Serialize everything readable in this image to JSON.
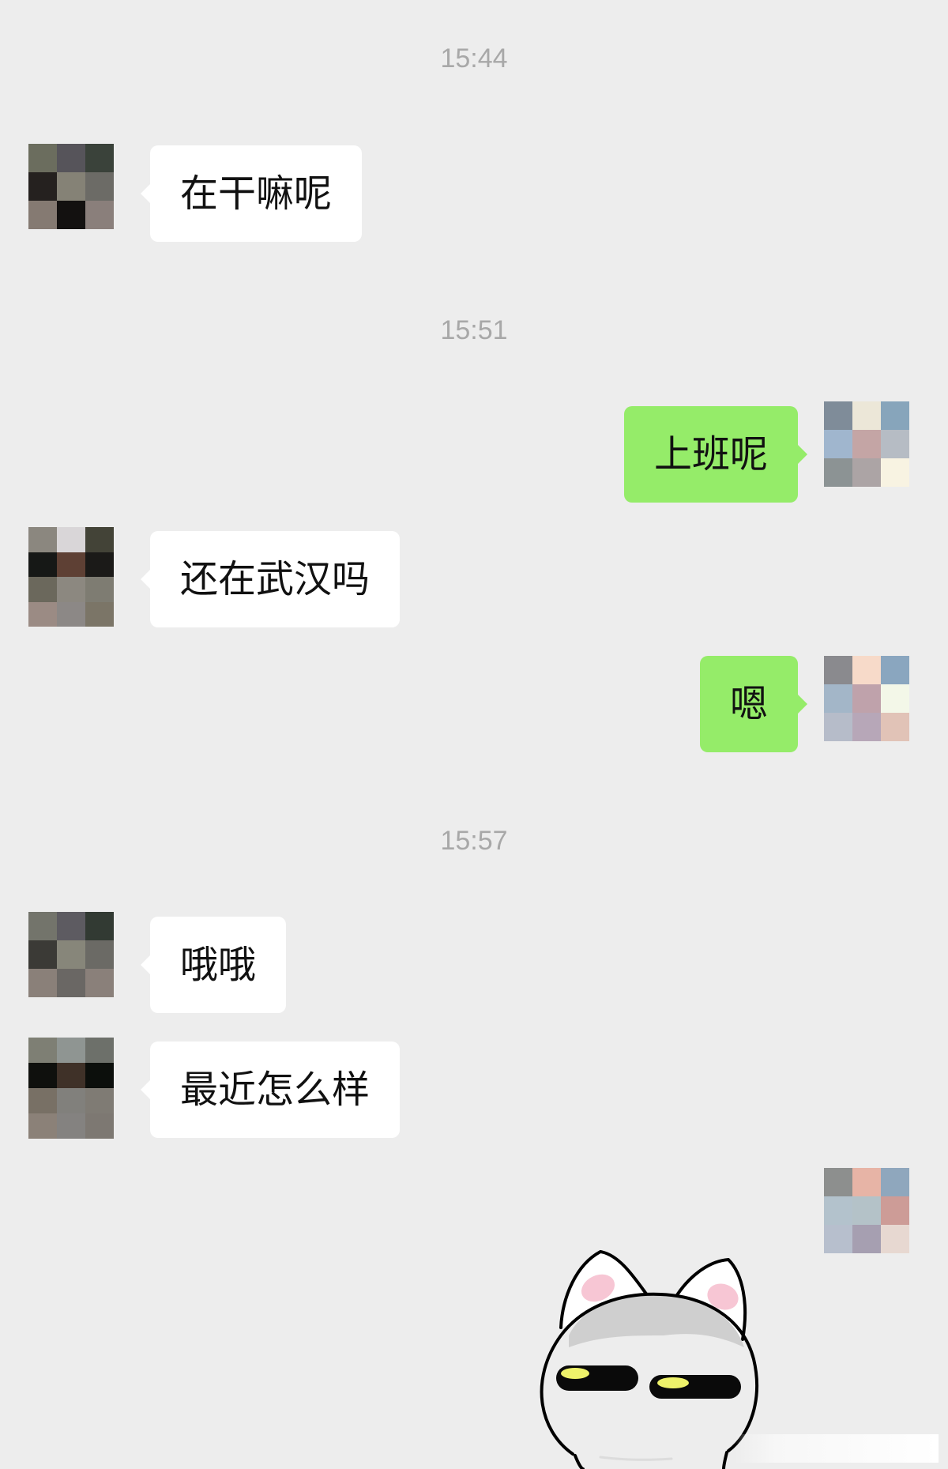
{
  "conversation": {
    "timestamps": [
      "15:44",
      "15:51",
      "15:57"
    ],
    "messages": [
      {
        "sender": "contact",
        "text": "在干嘛呢"
      },
      {
        "sender": "self",
        "text": "上班呢"
      },
      {
        "sender": "contact",
        "text": "还在武汉吗"
      },
      {
        "sender": "self",
        "text": "嗯"
      },
      {
        "sender": "contact",
        "text": "哦哦"
      },
      {
        "sender": "contact",
        "text": "最近怎么样"
      },
      {
        "sender": "self",
        "type": "sticker",
        "sticker": "smug-cat-sticker"
      }
    ]
  },
  "colors": {
    "background": "#ededed",
    "incoming_bubble": "#ffffff",
    "outgoing_bubble": "#95ec69",
    "timestamp_text": "#a8a8a8"
  },
  "avatars": {
    "contact": [
      [
        "#6b6d5e",
        "#56545a",
        "#3a423a",
        "#25211f",
        "#858276",
        "#6c6b66",
        "#857a72",
        "#131110",
        "#8a7f7b"
      ],
      [
        "#8b877f",
        "#d9d6d8",
        "#434337",
        "#161816",
        "#5e4034",
        "#1b1a18",
        "#6b685c",
        "#8c8880",
        "#7e7c72",
        "#9b8b84",
        "#8c8886",
        "#7b7567"
      ],
      [
        "#73746b",
        "#5d5b61",
        "#323a33",
        "#3b3a36",
        "#87867a",
        "#6b6a65",
        "#8a8079",
        "#6a6764",
        "#8a807a"
      ],
      [
        "#7e7f74",
        "#8f9592",
        "#6d706a",
        "#0f100d",
        "#3f3128",
        "#0c0f0c",
        "#787065",
        "#81807c",
        "#7f7b74",
        "#8b8178",
        "#848280",
        "#7d7872"
      ]
    ],
    "self": [
      [
        "#7f8c99",
        "#ece7d8",
        "#87a5bb",
        "#a0b6ce",
        "#c4a5a5",
        "#b6bcc4",
        "#8c9394",
        "#aca4a5",
        "#f8f3e2"
      ],
      [
        "#8a8a8e",
        "#f7dac9",
        "#8aa6bf",
        "#a3b6c8",
        "#bfa2ab",
        "#f3f7e8",
        "#b6bcc9",
        "#b7a7b8",
        "#e1c3b7"
      ],
      [
        "#8d8f8e",
        "#e7b4a6",
        "#8fa7bd",
        "#b3c2cc",
        "#b4c2c8",
        "#cd9c97",
        "#b7bfcd",
        "#a69fb1",
        "#e7d8d1"
      ]
    ]
  }
}
